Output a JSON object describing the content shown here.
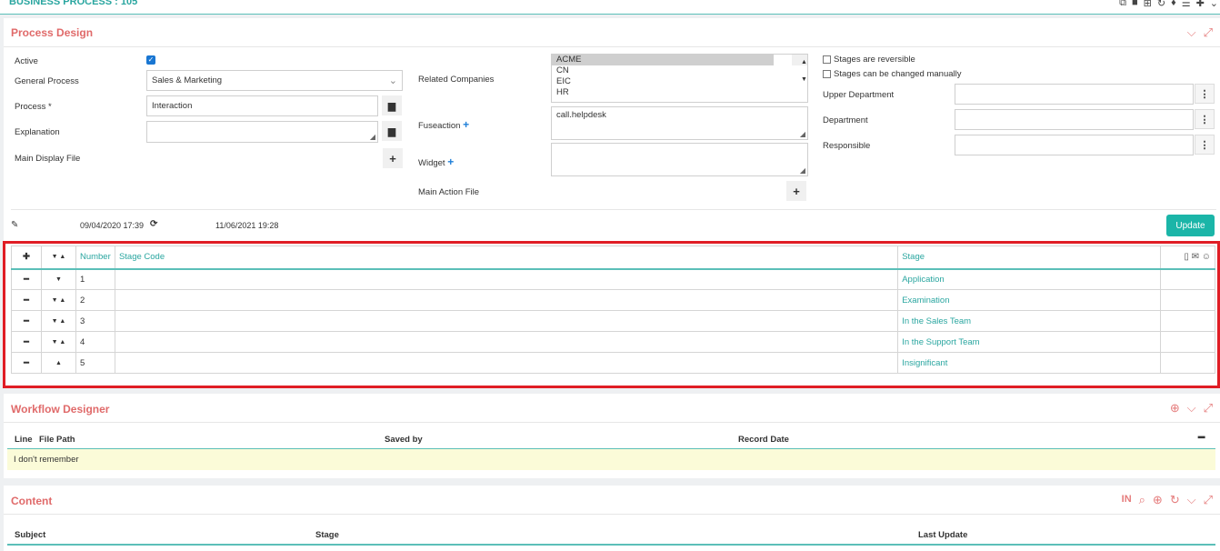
{
  "header": {
    "title": "BUSINESS PROCESS : 105"
  },
  "process_design": {
    "title": "Process Design",
    "active_label": "Active",
    "general_process_label": "General Process",
    "general_process_value": "Sales & Marketing",
    "process_label": "Process *",
    "process_value": "Interaction",
    "explanation_label": "Explanation",
    "explanation_value": "",
    "main_display_file_label": "Main Display File",
    "related_companies_label": "Related Companies",
    "related_companies": [
      "ACME",
      "CN",
      "EIC",
      "HR"
    ],
    "fuseaction_label": "Fuseaction",
    "fuseaction_value": "call.helpdesk",
    "widget_label": "Widget",
    "widget_value": "",
    "main_action_file_label": "Main Action File",
    "stages_reversible_label": "Stages are reversible",
    "stages_manual_label": "Stages can be changed manually",
    "upper_department_label": "Upper Department",
    "department_label": "Department",
    "responsible_label": "Responsible",
    "created_date": "09/04/2020 17:39",
    "updated_date": "11/06/2021 19:28",
    "update_button": "Update"
  },
  "stages_table": {
    "columns": {
      "number": "Number",
      "stage_code": "Stage Code",
      "stage": "Stage"
    },
    "rows": [
      {
        "number": "1",
        "stage_code": "",
        "stage": "Application"
      },
      {
        "number": "2",
        "stage_code": "",
        "stage": "Examination"
      },
      {
        "number": "3",
        "stage_code": "",
        "stage": "In the Sales Team"
      },
      {
        "number": "4",
        "stage_code": "",
        "stage": "In the Support Team"
      },
      {
        "number": "5",
        "stage_code": "",
        "stage": "Insignificant"
      }
    ]
  },
  "workflow_designer": {
    "title": "Workflow Designer",
    "columns": {
      "line": "Line",
      "file_path": "File Path",
      "saved_by": "Saved by",
      "record_date": "Record Date"
    },
    "empty_text": "I don't remember"
  },
  "content": {
    "title": "Content",
    "in_label": "IN",
    "columns": {
      "subject": "Subject",
      "stage": "Stage",
      "last_update": "Last Update"
    }
  }
}
